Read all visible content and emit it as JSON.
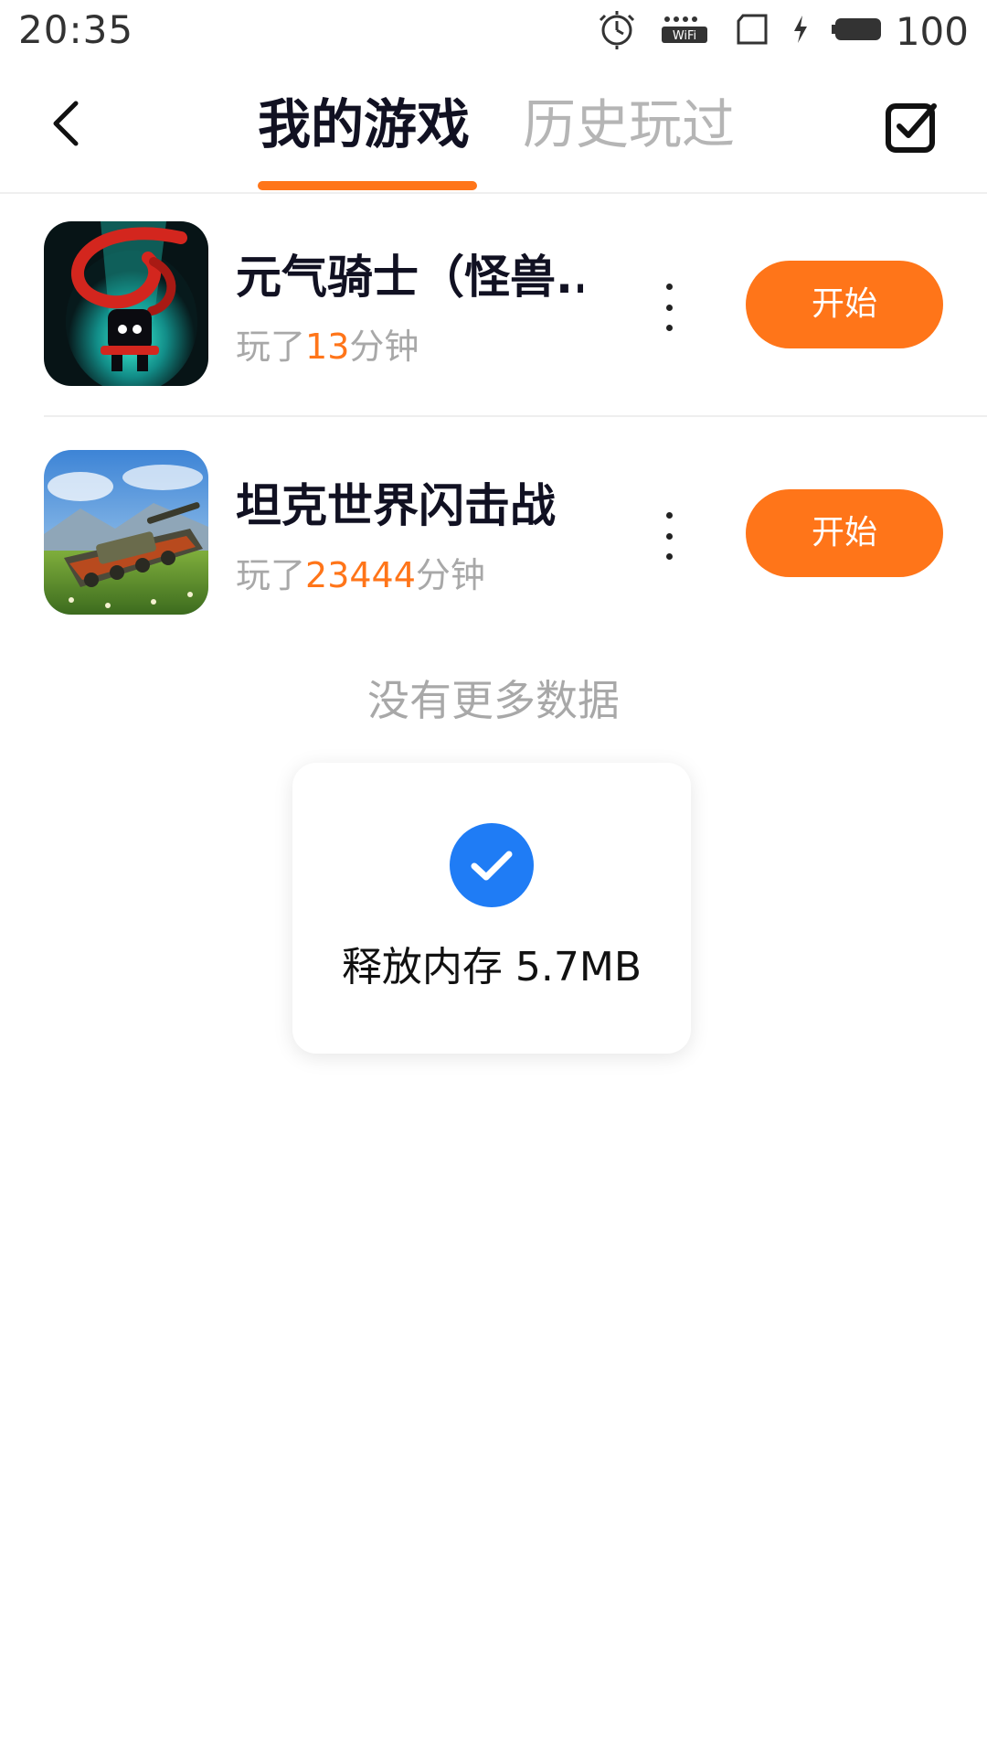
{
  "status_bar": {
    "time": "20:35",
    "battery_level": "100",
    "icons": [
      "alarm-icon",
      "wifi-icon",
      "sim-icon",
      "charging-icon",
      "battery-icon"
    ]
  },
  "header": {
    "tabs": [
      {
        "label": "我的游戏",
        "active": true
      },
      {
        "label": "历史玩过",
        "active": false
      }
    ],
    "accent_color": "#ff7519"
  },
  "games": [
    {
      "name": "元气骑士（怪兽..",
      "played_prefix": "玩了",
      "played_minutes": "13",
      "played_suffix": "分钟",
      "start_label": "开始",
      "icon": "soul-knight-app-icon"
    },
    {
      "name": "坦克世界闪击战",
      "played_prefix": "玩了",
      "played_minutes": "23444",
      "played_suffix": "分钟",
      "start_label": "开始",
      "icon": "world-of-tanks-blitz-app-icon"
    }
  ],
  "no_more_text": "没有更多数据",
  "toast": {
    "text": "释放内存 5.7MB",
    "icon": "check-circle-icon",
    "icon_color": "#1f7cf5"
  }
}
